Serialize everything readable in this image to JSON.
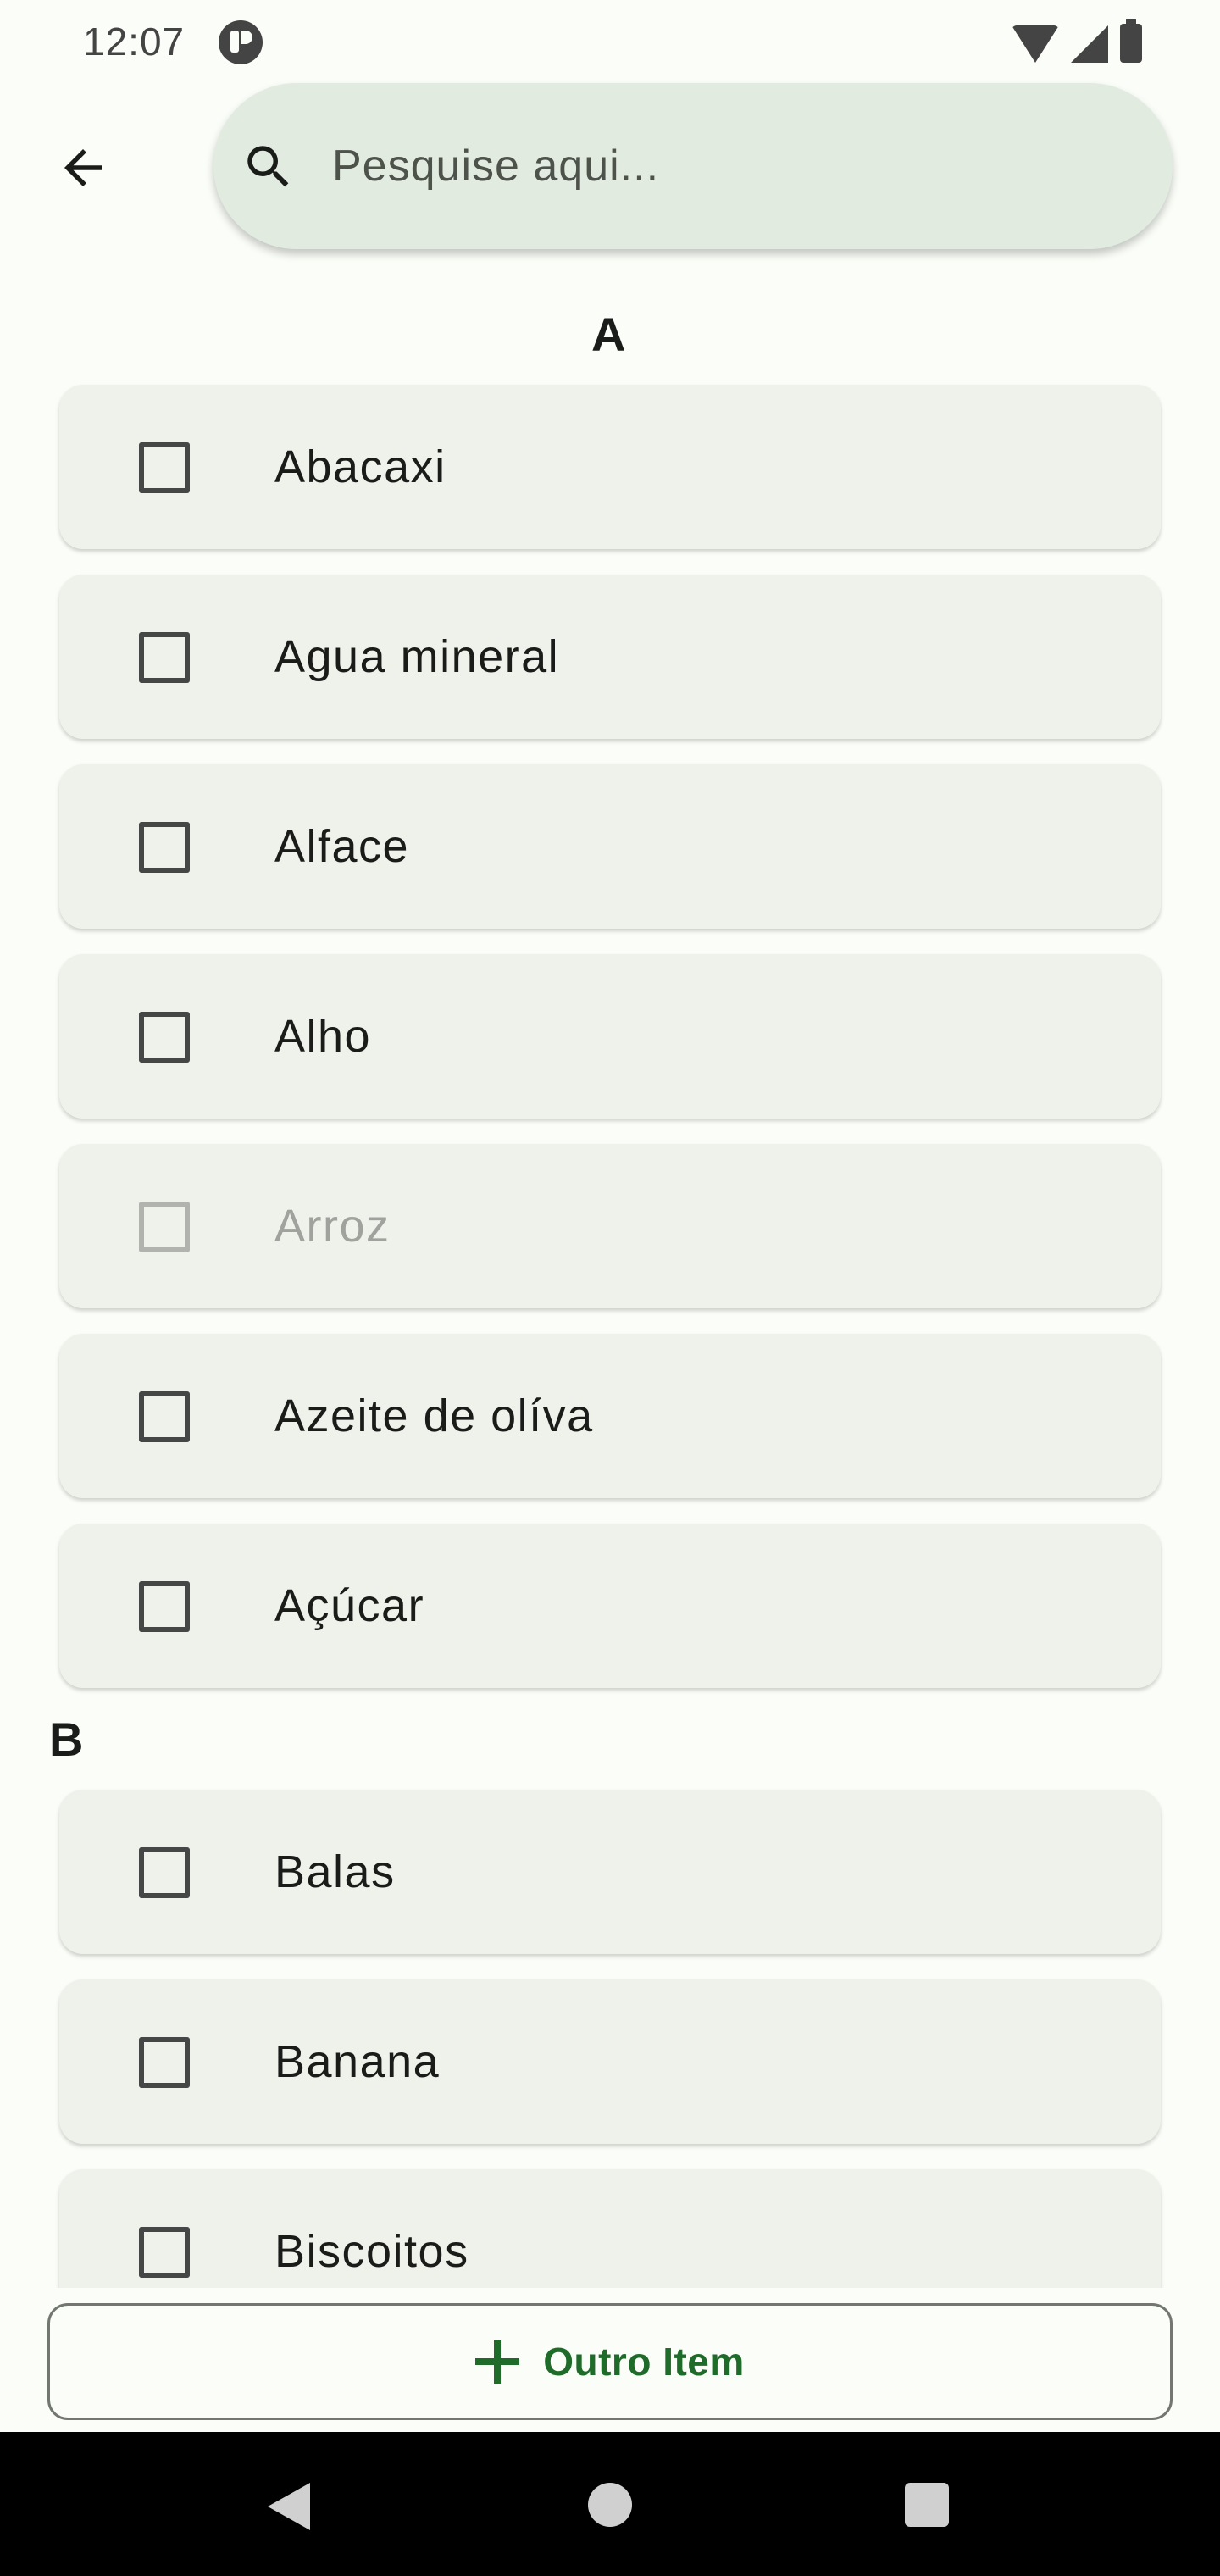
{
  "status_bar": {
    "time": "12:07",
    "icons": [
      "app-notification-icon",
      "wifi-icon",
      "signal-icon",
      "battery-icon"
    ]
  },
  "header": {
    "back_icon": "arrow-left-icon",
    "search": {
      "placeholder": "Pesquise aqui...",
      "value": "",
      "icon": "search-icon"
    }
  },
  "sections": [
    {
      "letter": "A",
      "items": [
        {
          "label": "Abacaxi",
          "checked": false,
          "disabled": false
        },
        {
          "label": "Agua mineral",
          "checked": false,
          "disabled": false
        },
        {
          "label": "Alface",
          "checked": false,
          "disabled": false
        },
        {
          "label": "Alho",
          "checked": false,
          "disabled": false
        },
        {
          "label": "Arroz",
          "checked": false,
          "disabled": true
        },
        {
          "label": "Azeite de olíva",
          "checked": false,
          "disabled": false
        },
        {
          "label": "Açúcar",
          "checked": false,
          "disabled": false
        }
      ]
    },
    {
      "letter": "B",
      "items": [
        {
          "label": "Balas",
          "checked": false,
          "disabled": false
        },
        {
          "label": "Banana",
          "checked": false,
          "disabled": false
        },
        {
          "label": "Biscoitos",
          "checked": false,
          "disabled": false
        }
      ]
    }
  ],
  "footer": {
    "add_button_label": "Outro Item",
    "add_icon": "plus-icon"
  },
  "colors": {
    "accent": "#1f6b2a",
    "card": "#eef2ea",
    "search_bg": "#e1ebdf",
    "background": "#fbfdf8"
  }
}
